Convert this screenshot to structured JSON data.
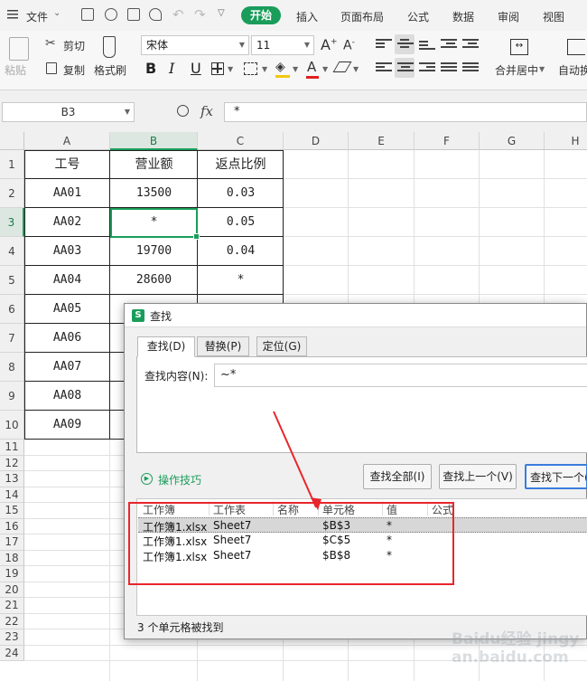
{
  "menu": {
    "file": "文件",
    "tabs": [
      "开始",
      "插入",
      "页面布局",
      "公式",
      "数据",
      "审阅",
      "视图"
    ]
  },
  "ribbon": {
    "paste": "粘贴",
    "cut": "剪切",
    "copy": "复制",
    "format_painter": "格式刷",
    "font_name": "宋体",
    "font_size": "11",
    "bold": "B",
    "italic": "I",
    "underline": "U",
    "merge_center": "合并居中",
    "auto_wrap": "自动换"
  },
  "formula_bar": {
    "cell_ref": "B3",
    "fx": "fx",
    "value": "*"
  },
  "sheet": {
    "columns": [
      "A",
      "B",
      "C",
      "D",
      "E",
      "F",
      "G",
      "H"
    ],
    "rows": [
      "1",
      "2",
      "3",
      "4",
      "5",
      "6",
      "7",
      "8",
      "9",
      "10",
      "11",
      "12",
      "13",
      "14",
      "15",
      "16",
      "17",
      "18",
      "19",
      "20",
      "21",
      "22",
      "23",
      "24"
    ],
    "headers": [
      "工号",
      "营业额",
      "返点比例"
    ],
    "data": [
      [
        "AA01",
        "13500",
        "0.03"
      ],
      [
        "AA02",
        "*",
        "0.05"
      ],
      [
        "AA03",
        "19700",
        "0.04"
      ],
      [
        "AA04",
        "28600",
        "*"
      ],
      [
        "AA05",
        "",
        ""
      ],
      [
        "AA06",
        "",
        ""
      ],
      [
        "AA07",
        "",
        ""
      ],
      [
        "AA08",
        "",
        ""
      ],
      [
        "AA09",
        "",
        ""
      ]
    ]
  },
  "find_dialog": {
    "title": "查找",
    "tabs": [
      "查找(D)",
      "替换(P)",
      "定位(G)"
    ],
    "find_label": "查找内容(N):",
    "find_value": "~*",
    "tips_link": "操作技巧",
    "buttons": {
      "find_all": "查找全部(I)",
      "find_prev": "查找上一个(V)",
      "find_next": "查找下一个("
    },
    "result_columns": [
      "工作簿",
      "工作表",
      "名称",
      "单元格",
      "值",
      "公式"
    ],
    "results": [
      [
        "工作簿1.xlsx",
        "Sheet7",
        "",
        "$B$3",
        "*",
        ""
      ],
      [
        "工作簿1.xlsx",
        "Sheet7",
        "",
        "$C$5",
        "*",
        ""
      ],
      [
        "工作簿1.xlsx",
        "Sheet7",
        "",
        "$B$8",
        "*",
        ""
      ]
    ],
    "status": "3 个单元格被找到"
  },
  "colors": {
    "accent": "#1a9d5a",
    "annotation": "#e8262d"
  },
  "watermark": "Baidu经验 jingyan.baidu.com"
}
